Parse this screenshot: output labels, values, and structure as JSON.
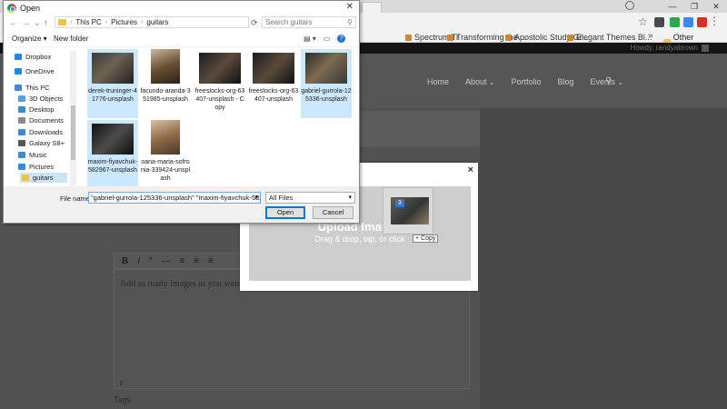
{
  "browser": {
    "bookmarks": [
      "Spectrum Tr",
      "Transforming the ...",
      "Apostolic Study Gr...",
      "Elegant Themes Bl..."
    ],
    "more_label": "»",
    "other_bookmarks": "Other bookmarks",
    "extension_colors": [
      "#4a4a4a",
      "#2aa84a",
      "#4285f4",
      "#d93025",
      "#2aa84a"
    ]
  },
  "site": {
    "howdy": "Howdy, randyabrown",
    "nav": [
      "Home",
      "About",
      "Portfolio",
      "Blog",
      "Events"
    ],
    "editor_toolbar": [
      "B",
      "I",
      "“",
      "—",
      "≡",
      "≡",
      "≡"
    ],
    "editor_placeholder": "Add as many images as you want...",
    "editor_path": "p",
    "tags_label": "Tags"
  },
  "upload_modal": {
    "close": "×",
    "title": "Upload Images",
    "subtitle": "Drag & drop, tap, or click",
    "drag_count": "3",
    "copy_badge": "+ Copy"
  },
  "open_dialog": {
    "title": "Open",
    "close": "✕",
    "breadcrumb": [
      "This PC",
      "Pictures",
      "guitars"
    ],
    "search_placeholder": "Search guitars",
    "organize": "Organize ▾",
    "new_folder": "New folder",
    "nav_items": [
      {
        "label": "Dropbox",
        "color": "#1e88e5"
      },
      {
        "label": "OneDrive",
        "color": "#1e88e5"
      },
      {
        "label": "This PC",
        "color": "#3b8ad9"
      },
      {
        "label": "3D Objects",
        "color": "#5aa0e0"
      },
      {
        "label": "Desktop",
        "color": "#3b8ad9"
      },
      {
        "label": "Documents",
        "color": "#8a8a8a"
      },
      {
        "label": "Downloads",
        "color": "#3b8ad9"
      },
      {
        "label": "Galaxy S8+",
        "color": "#555555"
      },
      {
        "label": "Music",
        "color": "#3b8ad9"
      },
      {
        "label": "Pictures",
        "color": "#3b8ad9"
      },
      {
        "label": "guitars",
        "color": "#e8c350"
      }
    ],
    "files": [
      {
        "name": "derek-truninger-41776-unsplash",
        "selected": true
      },
      {
        "name": "facundo-aranda-351985-unsplash",
        "selected": false
      },
      {
        "name": "freestocks-org-63407-unsplash - Copy",
        "selected": false
      },
      {
        "name": "freestocks-org-63407-unsplash",
        "selected": false
      },
      {
        "name": "gabriel-gurrola-125336-unsplash",
        "selected": true
      },
      {
        "name": "maxim-fiyavchuk-582967-unsplash",
        "selected": true
      },
      {
        "name": "oana-maria-sofronia-339424-unsplash",
        "selected": false
      }
    ],
    "file_name_label": "File name:",
    "file_name_value": "\"gabriel-gurrola-125336-unsplash\" \"maxim-fiyavchuk-582967-ur",
    "file_type": "All Files",
    "open_button": "Open",
    "cancel_button": "Cancel"
  }
}
